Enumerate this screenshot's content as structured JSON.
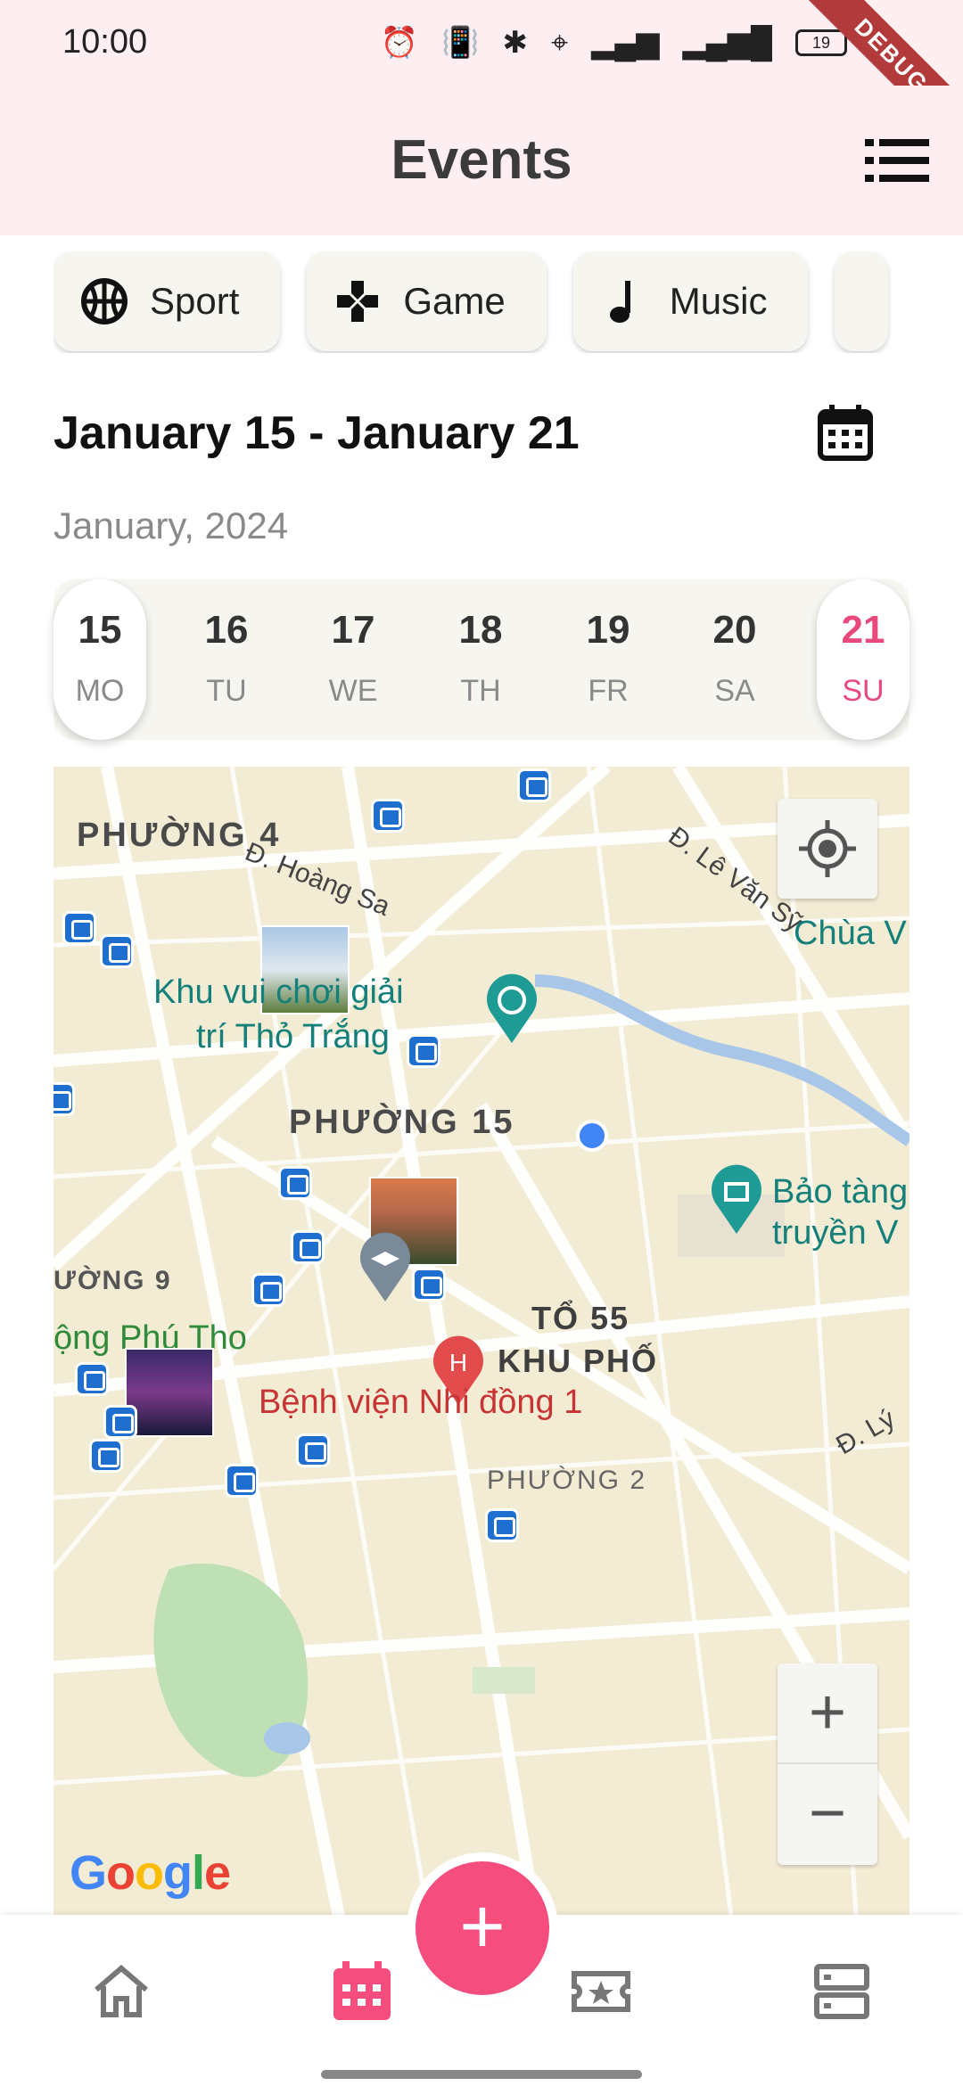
{
  "status_bar": {
    "time": "10:00",
    "icons": [
      "alarm-icon",
      "vibrate-off-icon",
      "bluetooth-icon",
      "location-icon",
      "signal-icon",
      "4g-signal-icon",
      "battery-icon"
    ],
    "battery_level": "19",
    "debug_ribbon": "DEBUG"
  },
  "app_bar": {
    "title": "Events",
    "menu_icon": "list-icon"
  },
  "categories": [
    {
      "label": "Sport",
      "icon": "basketball-icon"
    },
    {
      "label": "Game",
      "icon": "gamepad-icon"
    },
    {
      "label": "Music",
      "icon": "music-note-icon"
    }
  ],
  "week": {
    "range": "January 15 - January 21",
    "month": "January, 2024",
    "days": [
      {
        "num": "15",
        "dow": "MO"
      },
      {
        "num": "16",
        "dow": "TU"
      },
      {
        "num": "17",
        "dow": "WE"
      },
      {
        "num": "18",
        "dow": "TH"
      },
      {
        "num": "19",
        "dow": "FR"
      },
      {
        "num": "20",
        "dow": "SA"
      },
      {
        "num": "21",
        "dow": "SU"
      }
    ]
  },
  "map": {
    "labels": {
      "ward4": "PHƯỜNG 4",
      "ward15": "PHƯỜNG 15",
      "ward9": "ƯỜNG 9",
      "ward2": "PHƯỜNG 2",
      "hoang_sa": "Đ. Hoàng Sa",
      "le_van_sy": "Đ. Lê Văn Sỹ",
      "d_ly": "Đ. Lý",
      "chua": "Chùa V",
      "park_line1": "Khu vui chơi giải",
      "park_line2": "trí Thỏ Trắng",
      "museum_line1": "Bảo tàng",
      "museum_line2": "truyền V",
      "to55": "TỔ 55",
      "khupho": "KHU PHỐ",
      "phu_tho": "ộng Phú Tho",
      "hospital": "Bệnh viện Nhi đồng 1",
      "google": "Google"
    },
    "controls": {
      "zoom_in": "+",
      "zoom_out": "−"
    }
  },
  "bottom_nav": {
    "items": [
      "home-icon",
      "calendar-icon",
      "ticket-icon",
      "storage-icon"
    ],
    "fab_label": "+"
  },
  "colors": {
    "accent": "#f44d7e",
    "header_bg": "#fdeef1",
    "chip_bg": "#f6f5f0"
  }
}
